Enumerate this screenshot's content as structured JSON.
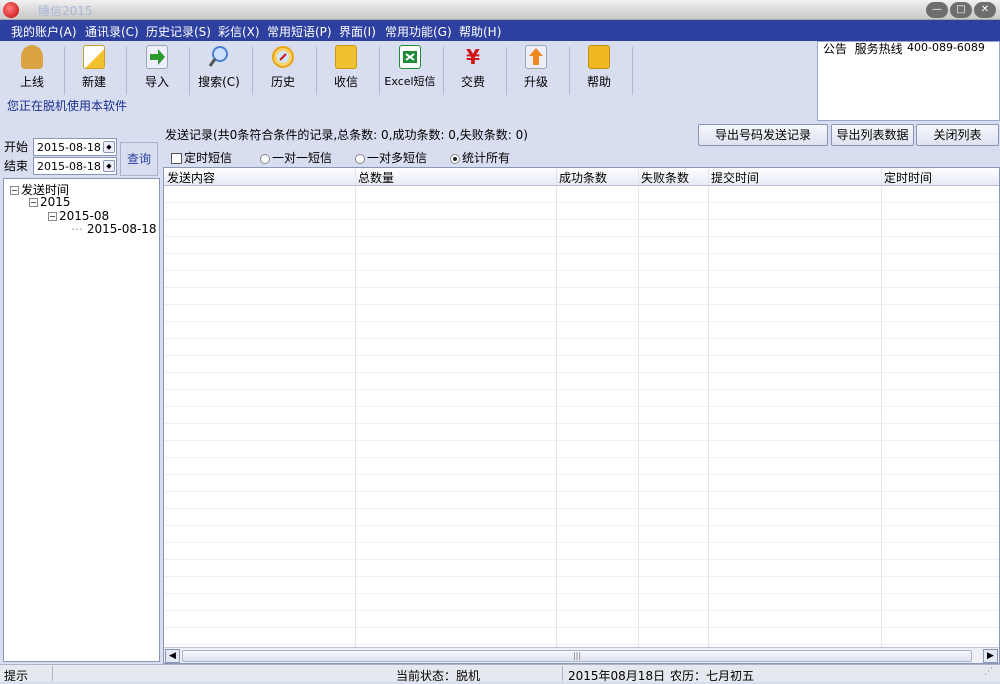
{
  "window": {
    "title": "睡信2015",
    "controls": [
      "minimize",
      "maximize",
      "close"
    ]
  },
  "menubar": {
    "items": [
      "我的账户(A)",
      "通讯录(C)",
      "历史记录(S)",
      "彩信(X)",
      "常用短语(P)",
      "界面(I)",
      "常用功能(G)",
      "帮助(H)"
    ]
  },
  "toolbar": {
    "buttons": [
      {
        "label": "上线",
        "icon": "person-icon",
        "color": "#d9a441"
      },
      {
        "label": "新建",
        "icon": "pencil-icon",
        "color": "#f2c230"
      },
      {
        "label": "导入",
        "icon": "import-arrow-icon",
        "color": "#2e9a2e"
      },
      {
        "label": "搜索(C)",
        "icon": "magnifier-icon",
        "color": "#4a7fd0"
      },
      {
        "label": "历史",
        "icon": "compass-icon",
        "color": "#e9a316"
      },
      {
        "label": "收信",
        "icon": "inbox-icon",
        "color": "#f0c030"
      },
      {
        "label": "Excel短信",
        "icon": "excel-icon",
        "color": "#1f8a3a"
      },
      {
        "label": "交费",
        "icon": "yen-icon",
        "color": "#d01818"
      },
      {
        "label": "升级",
        "icon": "upgrade-arrow-icon",
        "color": "#f08a20"
      },
      {
        "label": "帮助",
        "icon": "help-book-icon",
        "color": "#f0b820"
      }
    ],
    "status_message": "您正在脱机使用本软件"
  },
  "notice": {
    "label": "公告",
    "hotline_label": "服务热线",
    "hotline_number": "400-089-6089"
  },
  "date_filter": {
    "start_label": "开始",
    "start_value": "2015-08-18",
    "end_label": "结束",
    "end_value": "2015-08-18",
    "query_label": "查询"
  },
  "tree": {
    "root": "发送时间",
    "year": "2015",
    "month": "2015-08",
    "day": "2015-08-18"
  },
  "records": {
    "summary": "发送记录(共0条符合条件的记录,总条数: 0,成功条数: 0,失败条数: 0)",
    "export_numbers_label": "导出号码发送记录",
    "export_list_label": "导出列表数据",
    "close_list_label": "关闭列表"
  },
  "filters": {
    "scheduled_label": "定时短信",
    "scheduled_checked": false,
    "options": [
      "一对一短信",
      "一对多短信",
      "统计所有"
    ],
    "selected": "统计所有"
  },
  "grid": {
    "columns": [
      "发送内容",
      "总数量",
      "成功条数",
      "失败条数",
      "提交时间",
      "定时时间"
    ],
    "rows": []
  },
  "statusbar": {
    "hint": "提示",
    "current_status": "当前状态：脱机",
    "date": "2015年08月18日",
    "lunar": "农历：七月初五"
  }
}
